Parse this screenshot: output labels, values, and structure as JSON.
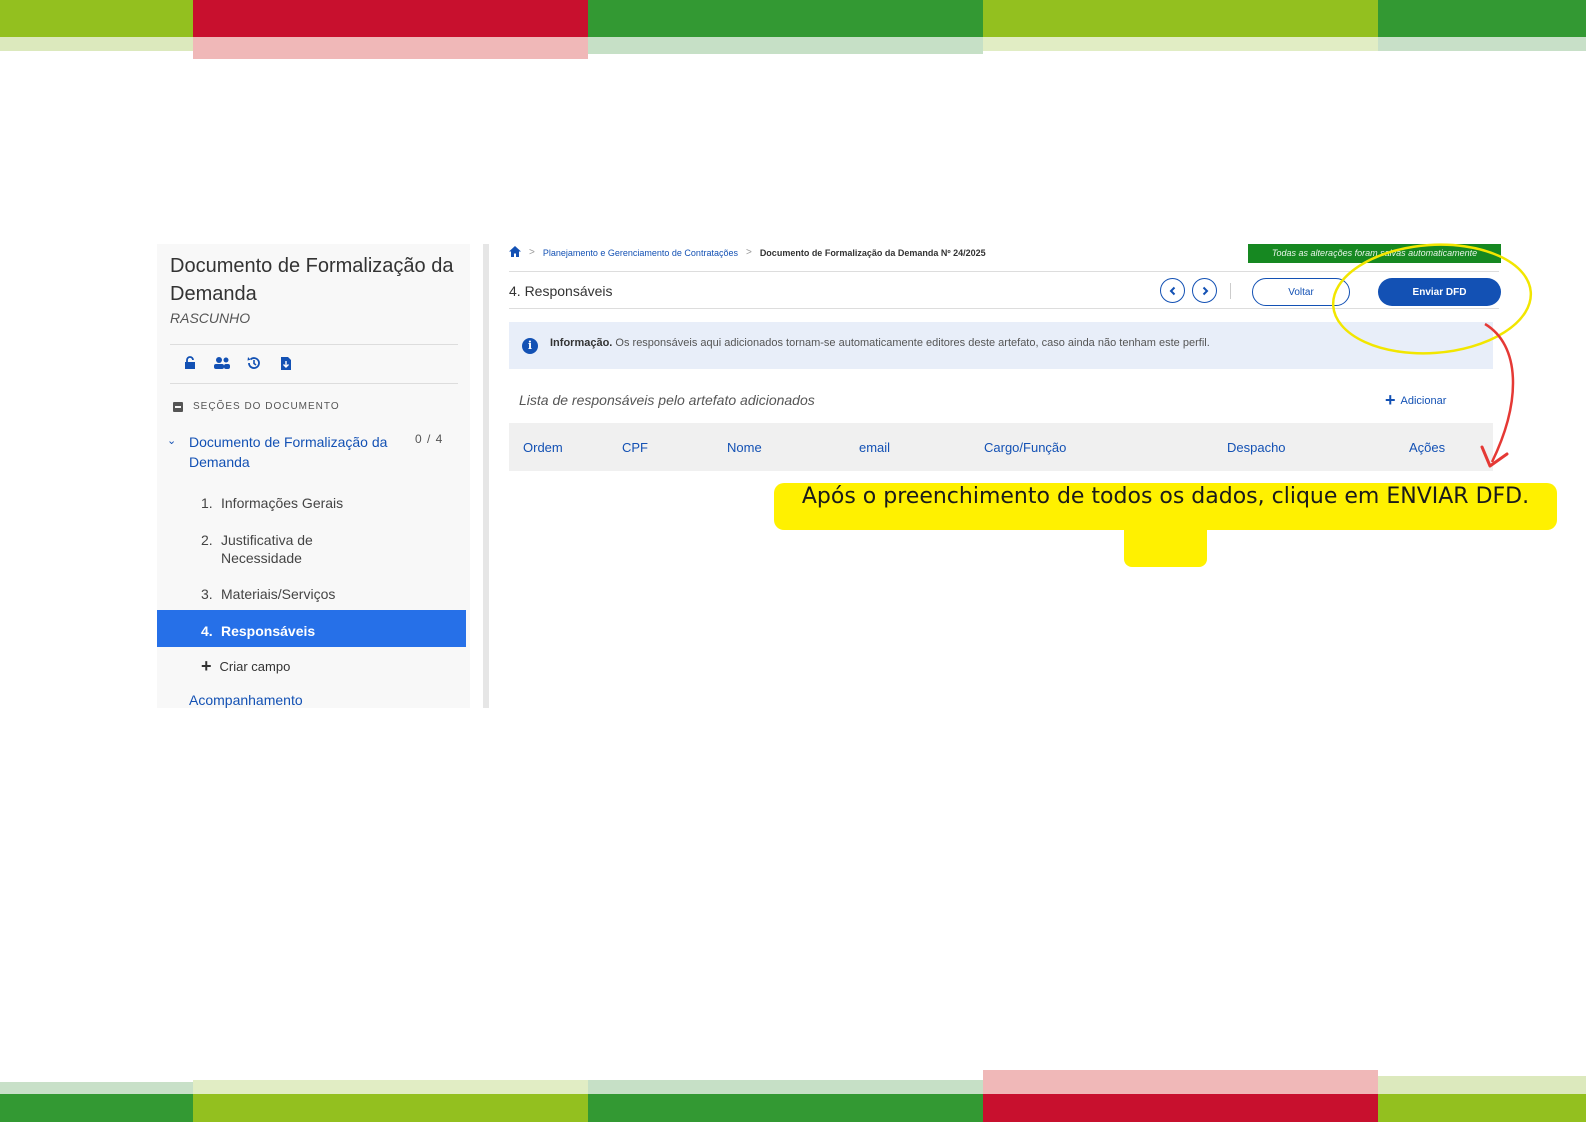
{
  "sidebar": {
    "title": "Documento de Formalização da Demanda",
    "status": "RASCUNHO",
    "section_header": "SEÇÕES DO DOCUMENTO",
    "tree_parent": "Documento de Formalização da Demanda",
    "tree_count": "0 / 4",
    "items": [
      {
        "num": "1.",
        "label": "Informações Gerais"
      },
      {
        "num": "2.",
        "label": "Justificativa de Necessidade"
      },
      {
        "num": "3.",
        "label": "Materiais/Serviços"
      },
      {
        "num": "4.",
        "label": "Responsáveis"
      }
    ],
    "criar_campo": "Criar campo",
    "acompanhamento": "Acompanhamento"
  },
  "breadcrumb": {
    "item1": "Planejamento e Gerenciamento de Contratações",
    "item2": "Documento de Formalização da Demanda Nº 24/2025"
  },
  "toast": "Todas as alterações foram salvas automaticamente",
  "step_title": "4. Responsáveis",
  "buttons": {
    "voltar": "Voltar",
    "enviar": "Enviar DFD",
    "adicionar": "Adicionar"
  },
  "info": {
    "bold": "Informação.",
    "text": " Os responsáveis aqui adicionados tornam-se automaticamente editores deste artefato, caso ainda não tenham este perfil."
  },
  "list_title": "Lista de responsáveis pelo artefato adicionados",
  "table": {
    "columns": [
      "Ordem",
      "CPF",
      "Nome",
      "email",
      "Cargo/Função",
      "Despacho",
      "Ações"
    ]
  },
  "callout": "Após o preenchimento de todos os dados, clique em ENVIAR DFD.",
  "colors": {
    "primary": "#1351b4",
    "active": "#2670e8",
    "toast": "#168821",
    "highlight": "#fff100",
    "arrow": "#e53935",
    "stripe_red": "#c8102e",
    "stripe_green": "#339933",
    "stripe_lime": "#93c01f"
  },
  "icons": [
    "home-icon",
    "unlock-icon",
    "users-icon",
    "history-icon",
    "export-icon",
    "chevron-left-icon",
    "chevron-right-icon",
    "info-icon",
    "plus-icon",
    "chevron-down-icon"
  ]
}
